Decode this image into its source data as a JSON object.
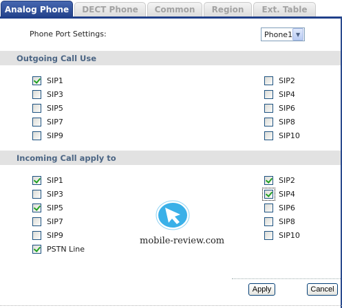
{
  "tabs": [
    {
      "label": "Analog Phone",
      "active": true
    },
    {
      "label": "DECT Phone",
      "active": false
    },
    {
      "label": "Common",
      "active": false
    },
    {
      "label": "Region",
      "active": false
    },
    {
      "label": "Ext. Table",
      "active": false
    }
  ],
  "port": {
    "label": "Phone Port Settings:",
    "selected": "Phone1"
  },
  "outgoing": {
    "title": "Outgoing Call Use",
    "items": [
      {
        "label": "SIP1",
        "checked": true
      },
      {
        "label": "SIP2",
        "checked": false
      },
      {
        "label": "SIP3",
        "checked": false
      },
      {
        "label": "SIP4",
        "checked": false
      },
      {
        "label": "SIP5",
        "checked": false
      },
      {
        "label": "SIP6",
        "checked": false
      },
      {
        "label": "SIP7",
        "checked": false
      },
      {
        "label": "SIP8",
        "checked": false
      },
      {
        "label": "SIP9",
        "checked": false
      },
      {
        "label": "SIP10",
        "checked": false
      }
    ]
  },
  "incoming": {
    "title": "Incoming Call apply to",
    "items": [
      {
        "label": "SIP1",
        "checked": true
      },
      {
        "label": "SIP2",
        "checked": true
      },
      {
        "label": "SIP3",
        "checked": false
      },
      {
        "label": "SIP4",
        "checked": true,
        "focused": true
      },
      {
        "label": "SIP5",
        "checked": true
      },
      {
        "label": "SIP6",
        "checked": false
      },
      {
        "label": "SIP7",
        "checked": false
      },
      {
        "label": "SIP8",
        "checked": false
      },
      {
        "label": "SIP9",
        "checked": false
      },
      {
        "label": "SIP10",
        "checked": false
      },
      {
        "label": "PSTN Line",
        "checked": true
      }
    ]
  },
  "watermark": {
    "text": "mobile-review.com"
  },
  "buttons": {
    "apply": "Apply",
    "cancel": "Cancel"
  },
  "colors": {
    "active_tab": "#2d4f9e",
    "section_header_bg": "#e2e2e2",
    "section_header_text": "#4b6584",
    "check_mark": "#21a121"
  }
}
